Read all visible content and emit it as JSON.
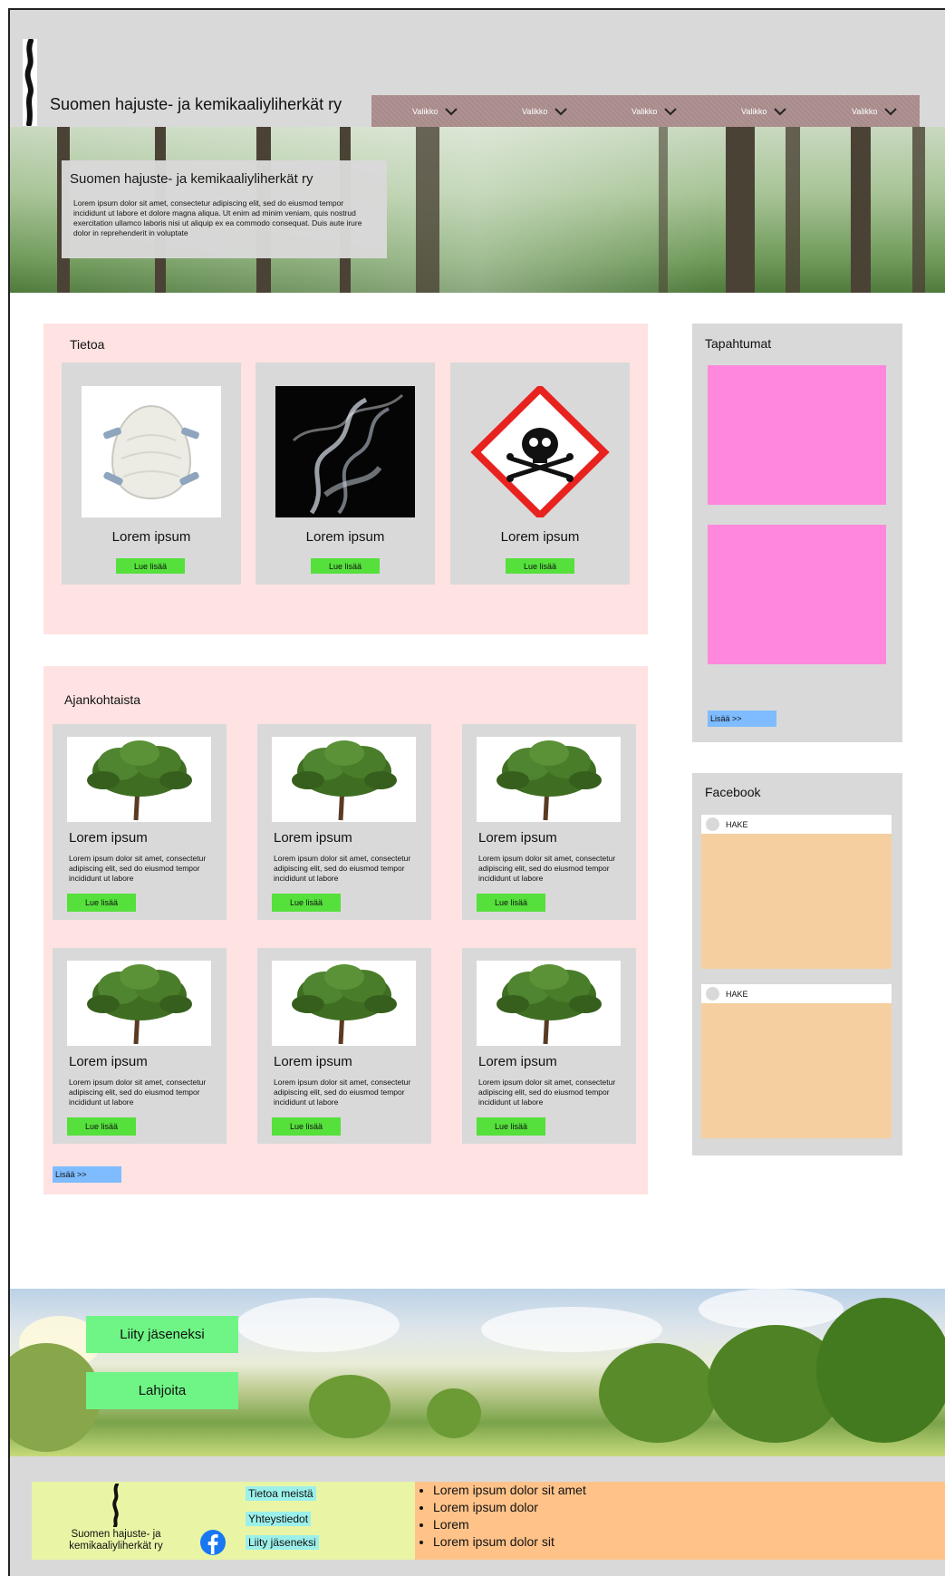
{
  "header": {
    "site_title": "Suomen hajuste- ja kemikaaliyliherkät ry",
    "nav": [
      "Valikko",
      "Valikko",
      "Valikko",
      "Valikko",
      "Valikko"
    ]
  },
  "hero": {
    "title": "Suomen hajuste- ja kemikaaliyliherkät ry",
    "text": "Lorem ipsum dolor sit amet, consectetur adipiscing elit, sed do eiusmod tempor incididunt ut labore et dolore magna aliqua. Ut enim ad minim veniam, quis nostrud exercitation ullamco laboris nisi ut aliquip ex ea commodo consequat. Duis aute irure dolor in reprehenderit in voluptate"
  },
  "tietoa": {
    "title": "Tietoa",
    "cards": [
      {
        "title": "Lorem ipsum",
        "button": "Lue lisää",
        "image": "mask-icon"
      },
      {
        "title": "Lorem ipsum",
        "button": "Lue lisää",
        "image": "smoke-icon"
      },
      {
        "title": "Lorem ipsum",
        "button": "Lue lisää",
        "image": "toxic-hazard-icon"
      }
    ]
  },
  "ajankohtaista": {
    "title": "Ajankohtaista",
    "cards": [
      {
        "title": "Lorem ipsum",
        "text": "Lorem ipsum dolor sit amet, consectetur adipiscing elit, sed do eiusmod tempor incididunt ut labore",
        "button": "Lue lisää"
      },
      {
        "title": "Lorem ipsum",
        "text": "Lorem ipsum dolor sit amet, consectetur adipiscing elit, sed do eiusmod tempor incididunt ut labore",
        "button": "Lue lisää"
      },
      {
        "title": "Lorem ipsum",
        "text": "Lorem ipsum dolor sit amet, consectetur adipiscing elit, sed do eiusmod tempor incididunt ut labore",
        "button": "Lue lisää"
      },
      {
        "title": "Lorem ipsum",
        "text": "Lorem ipsum dolor sit amet, consectetur adipiscing elit, sed do eiusmod tempor incididunt ut labore",
        "button": "Lue lisää"
      },
      {
        "title": "Lorem ipsum",
        "text": "Lorem ipsum dolor sit amet, consectetur adipiscing elit, sed do eiusmod tempor incididunt ut labore",
        "button": "Lue lisää"
      },
      {
        "title": "Lorem ipsum",
        "text": "Lorem ipsum dolor sit amet, consectetur adipiscing elit, sed do eiusmod tempor incididunt ut labore",
        "button": "Lue lisää"
      }
    ],
    "more": "Lisää >>"
  },
  "tapahtumat": {
    "title": "Tapahtumat",
    "more": "Lisää >>"
  },
  "facebook": {
    "title": "Facebook",
    "posts": [
      {
        "label": "HAKE"
      },
      {
        "label": "HAKE"
      }
    ]
  },
  "cta": {
    "join": "Liity jäseneksi",
    "donate": "Lahjoita"
  },
  "footer": {
    "org_name": "Suomen hajuste- ja kemikaaliyliherkät ry",
    "links": [
      "Tietoa meistä",
      "Yhteystiedot",
      "Liity jäseneksi"
    ],
    "list": [
      "Lorem ipsum dolor sit amet",
      "Lorem ipsum dolor",
      "Lorem",
      "Lorem ipsum dolor sit"
    ],
    "facebook_icon": "facebook-icon"
  },
  "colors": {
    "header_bg": "#d9d9d9",
    "nav_bg": "#a88a8a",
    "panel_pink": "#ffe3e3",
    "button_green": "#55e03c",
    "button_blue": "#7ebcff",
    "event_pink": "#ff88dd",
    "fb_body": "#f5cfa0",
    "cta_green": "#6ff585",
    "footer_yellow": "#e9f5a5",
    "footer_orange": "#ffc38a",
    "footer_link": "#9cf0ea"
  }
}
